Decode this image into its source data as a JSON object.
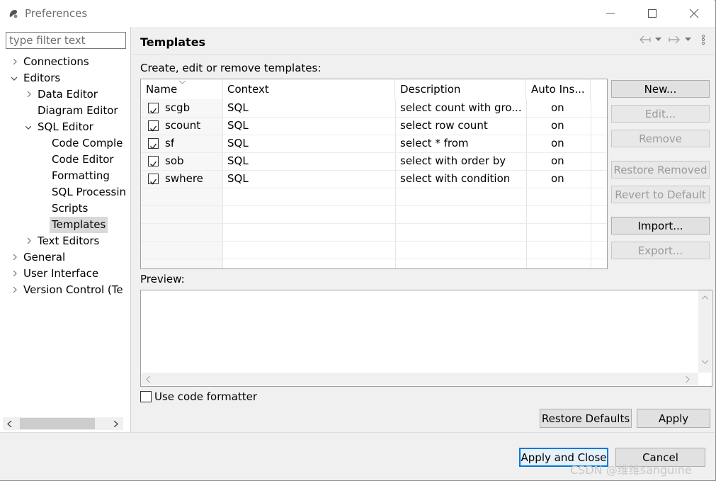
{
  "window": {
    "title": "Preferences"
  },
  "filter": {
    "placeholder": "type filter text"
  },
  "tree": {
    "items": [
      {
        "label": "Connections"
      },
      {
        "label": "Editors"
      },
      {
        "label": "Data Editor"
      },
      {
        "label": "Diagram Editor"
      },
      {
        "label": "SQL Editor"
      },
      {
        "label": "Code Comple"
      },
      {
        "label": "Code Editor"
      },
      {
        "label": "Formatting"
      },
      {
        "label": "SQL Processin"
      },
      {
        "label": "Scripts"
      },
      {
        "label": "Templates"
      },
      {
        "label": "Text Editors"
      },
      {
        "label": "General"
      },
      {
        "label": "User Interface"
      },
      {
        "label": "Version Control (Te"
      }
    ]
  },
  "page": {
    "title": "Templates",
    "description": "Create, edit or remove templates:",
    "preview_label": "Preview:",
    "use_formatter_label": "Use code formatter"
  },
  "table": {
    "columns": [
      "Name",
      "Context",
      "Description",
      "Auto Ins..."
    ],
    "rows": [
      {
        "name": "scgb",
        "context": "SQL",
        "description": "select count with gro...",
        "auto": "on"
      },
      {
        "name": "scount",
        "context": "SQL",
        "description": "select row count",
        "auto": "on"
      },
      {
        "name": "sf",
        "context": "SQL",
        "description": "select * from",
        "auto": "on"
      },
      {
        "name": "sob",
        "context": "SQL",
        "description": "select with order by",
        "auto": "on"
      },
      {
        "name": "swhere",
        "context": "SQL",
        "description": "select with condition",
        "auto": "on"
      }
    ]
  },
  "buttons": {
    "new": "New...",
    "edit": "Edit...",
    "remove": "Remove",
    "restore_removed": "Restore Removed",
    "revert_default": "Revert to Default",
    "import": "Import...",
    "export": "Export...",
    "restore_defaults": "Restore Defaults",
    "apply": "Apply",
    "apply_close": "Apply and Close",
    "cancel": "Cancel"
  },
  "watermark": "CSDN @维维sanguine"
}
